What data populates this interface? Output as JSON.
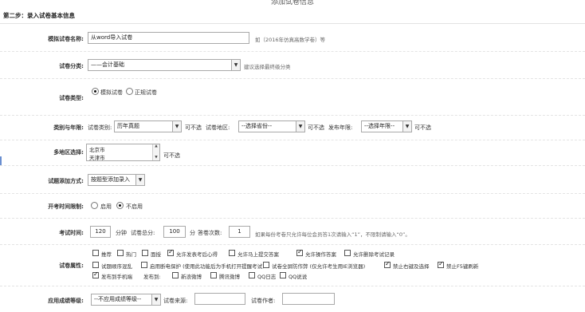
{
  "header": {
    "title": "添加试卷信息"
  },
  "step": {
    "title": "第二步：录入试卷基本信息"
  },
  "fields": {
    "paper_name": {
      "label": "模拟试卷名称:",
      "value": "从word导入试卷",
      "hint": "如（2016年仿真高数学卷）等"
    },
    "paper_category": {
      "label": "试卷分类:",
      "value": "——会计基础",
      "hint": "建议选择最终级分类"
    },
    "paper_type": {
      "label": "试卷类型:",
      "options": [
        "模拟试卷",
        "正规试卷"
      ],
      "selected": "模拟试卷"
    },
    "category_year": {
      "label": "类别与年限:",
      "exam_category_label": "试卷类别:",
      "exam_category_value": "历年真题",
      "nolimit1": "可不选",
      "region_label": "试卷地区:",
      "region_value": "--选择省份--",
      "nolimit2": "可不选",
      "year_label": "发布年限:",
      "year_value": "--选择年限--",
      "nolimit3": "可不选"
    },
    "multi_region": {
      "label": "多地区选择:",
      "options": [
        "北京市",
        "天津市"
      ],
      "nolimit": "可不选"
    },
    "question_add": {
      "label": "试题添加方式:",
      "value": "按题型添加录入"
    },
    "start_limit": {
      "label": "开考时间限制:",
      "options": [
        "启用",
        "不启用"
      ],
      "selected": "不启用"
    },
    "exam_time": {
      "label": "考试时间:",
      "minutes": "120",
      "minutes_unit": "分钟",
      "total_label": "试卷总分:",
      "total": "100",
      "total_unit": "分",
      "attempts_label": "答卷次数:",
      "attempts": "1",
      "hint": "如果每份考卷只允许每位会员答1次请输入“1”，不限制请输入“0”。"
    },
    "attributes": {
      "label": "试卷属性:",
      "row1": [
        {
          "text": "推荐",
          "checked": false
        },
        {
          "text": "热门",
          "checked": false
        },
        {
          "text": "面授",
          "checked": false
        },
        {
          "text": "允许发表考后心得",
          "checked": true
        },
        {
          "text": "允许马上提交答案",
          "checked": false
        },
        {
          "text": "允许操作答案",
          "checked": true
        },
        {
          "text": "允许删除考试记录",
          "checked": false
        }
      ],
      "row2": [
        {
          "text": "试题顺序混乱",
          "checked": false
        },
        {
          "text": "启用断电保护 (使用此功能后为手机打开提醒考试)",
          "checked": false
        },
        {
          "text": "试卷全屏防作弊 (仅允许考生用IE浏览器)",
          "checked": false
        },
        {
          "text": "禁止右键及选择",
          "checked": true
        },
        {
          "text": "禁止F5键刷新",
          "checked": true
        }
      ],
      "row3": [
        {
          "text": "发布到手机端",
          "checked": true
        }
      ],
      "publish_label": "发布到:",
      "publish_to": [
        {
          "text": "新浪微博",
          "checked": false
        },
        {
          "text": "腾讯微博",
          "checked": false
        },
        {
          "text": "QQ日志",
          "checked": false
        },
        {
          "text": "QQ说说",
          "checked": false
        }
      ]
    },
    "grade": {
      "label": "应用成绩等级:",
      "value": "--不应用成绩等级--",
      "source_label": "试卷来源:",
      "source_value": "",
      "author_label": "试卷作者:",
      "author_value": ""
    }
  }
}
